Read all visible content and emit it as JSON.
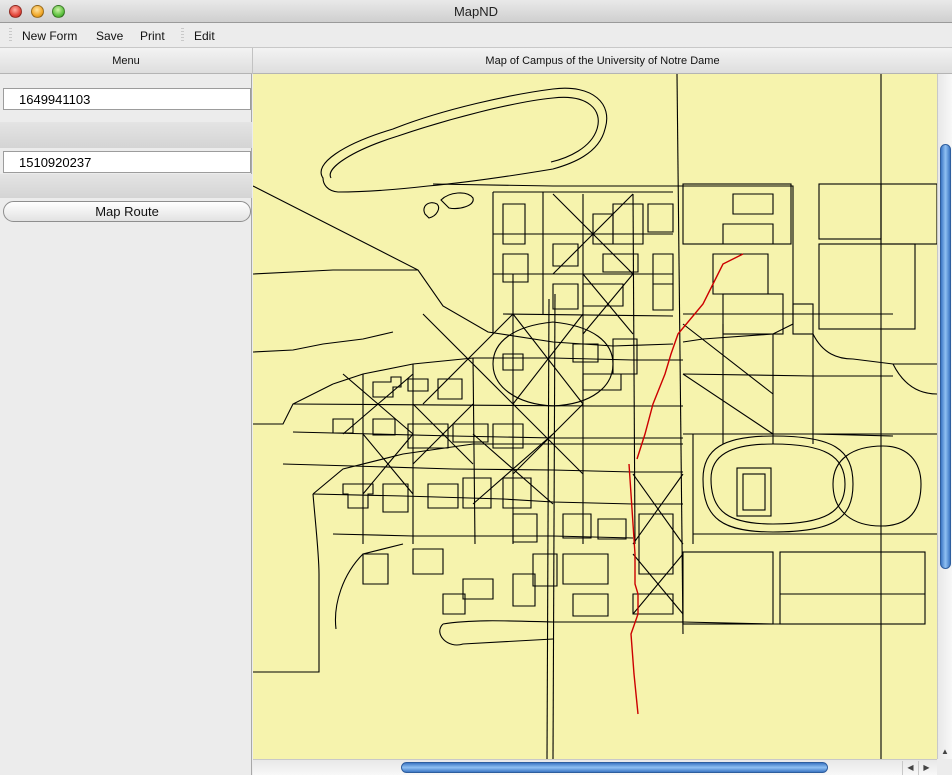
{
  "window": {
    "title": "MapND"
  },
  "menubar": {
    "items": [
      {
        "label": "New Form"
      },
      {
        "label": "Save"
      },
      {
        "label": "Print"
      },
      {
        "label": "Edit"
      }
    ]
  },
  "panel_headers": {
    "menu": "Menu",
    "map": "Map of Campus of the University of Notre Dame"
  },
  "sidebar": {
    "start_building_id": "1649941103",
    "end_building_id": "1510920237",
    "map_route_label": "Map Route"
  },
  "map": {
    "background_color": "#f6f3ad",
    "path_color": "#000000",
    "route_color": "#cc0000"
  },
  "scrollbars": {
    "arrow_up": "▲",
    "arrow_left": "◀",
    "arrow_right": "▶"
  }
}
